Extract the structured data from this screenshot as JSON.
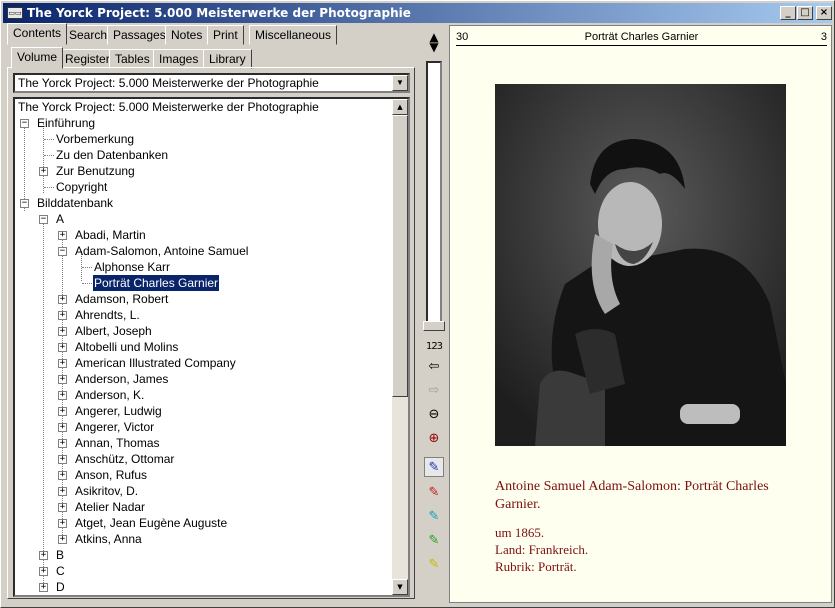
{
  "window": {
    "title": "The Yorck Project: 5.000 Meisterwerke der Photographie",
    "icon": "book-icon"
  },
  "tabs_top": [
    {
      "label": "Contents"
    },
    {
      "label": "Search"
    },
    {
      "label": "Passages"
    },
    {
      "label": "Notes"
    },
    {
      "label": "Print"
    },
    {
      "label": "Miscellaneous"
    }
  ],
  "tabs_sub": [
    {
      "label": "Volume"
    },
    {
      "label": "Register"
    },
    {
      "label": "Tables"
    },
    {
      "label": "Images"
    },
    {
      "label": "Library"
    }
  ],
  "volume_select": {
    "value": "The Yorck Project: 5.000 Meisterwerke der Photographie"
  },
  "tree": {
    "root": "The Yorck Project: 5.000 Meisterwerke der Photographie",
    "einfuehrung": "Einführung",
    "vorbemerkung": "Vorbemerkung",
    "zu_den_datenbanken": "Zu den Datenbanken",
    "zur_benutzung": "Zur Benutzung",
    "copyright": "Copyright",
    "bilddatenbank": "Bilddatenbank",
    "letter_a": "A",
    "a_items": [
      "Abadi, Martin",
      "Adam-Salomon, Antoine Samuel",
      "Adamson, Robert",
      "Ahrendts, L.",
      "Albert, Joseph",
      "Altobelli und Molins",
      "American Illustrated Company",
      "Anderson, James",
      "Anderson, K.",
      "Angerer, Ludwig",
      "Angerer, Victor",
      "Annan, Thomas",
      "Anschütz, Ottomar",
      "Anson, Rufus",
      "Asikritov, D.",
      "Atelier Nadar",
      "Atget, Jean Eugène Auguste",
      "Atkins, Anna"
    ],
    "adam_children": [
      "Alphonse Karr",
      "Porträt Charles Garnier"
    ],
    "letters_more": [
      "B",
      "C",
      "D"
    ]
  },
  "page_toolbar": {
    "page_numbers_label": "123"
  },
  "document": {
    "page_left": "30",
    "page_title": "Porträt Charles Garnier",
    "page_right": "3",
    "caption": "Antoine Samuel Adam-Salomon: Porträt Charles Garnier.",
    "date": "um 1865.",
    "land": "Land: Frankreich.",
    "rubrik": "Rubrik: Porträt."
  },
  "colors": {
    "titlebar_start": "#0a246a",
    "titlebar_end": "#a6caf0",
    "caption": "#7a1010",
    "selection": "#0a246a",
    "paper": "#fffff0"
  }
}
